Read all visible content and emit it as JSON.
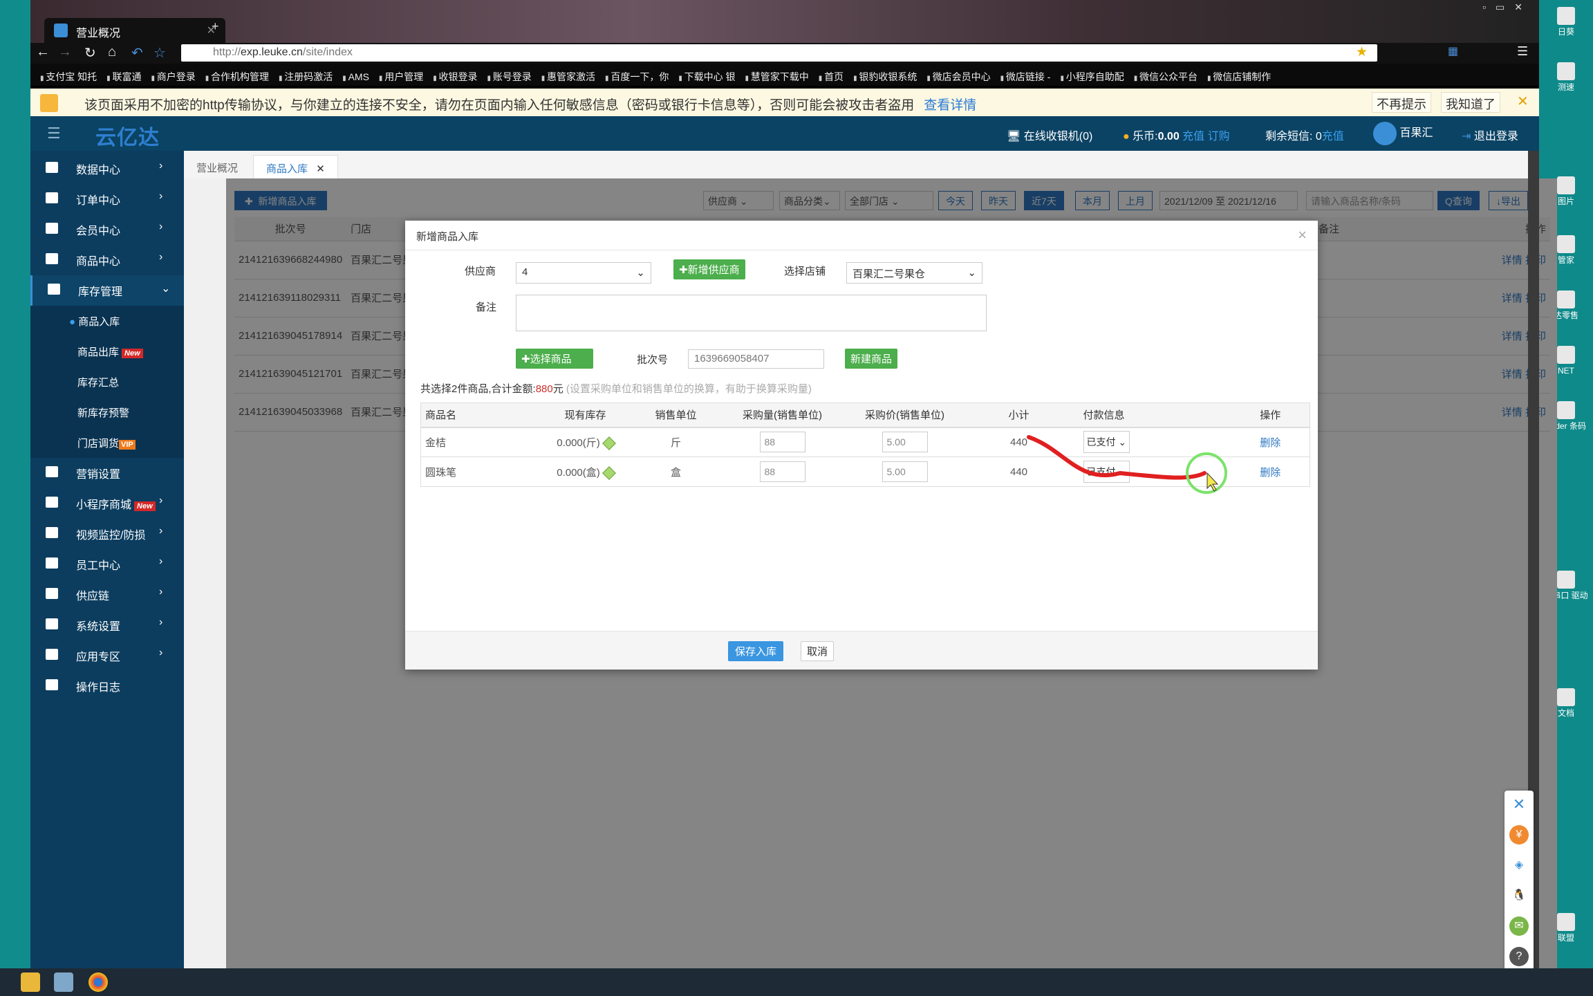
{
  "browser": {
    "tab_title": "营业概况",
    "url_scheme": "http://",
    "url_host": "exp.leuke.cn",
    "url_path": "/site/index",
    "bookmarks": [
      "支付宝 知托",
      "联富通",
      "商户登录",
      "合作机构管理",
      "注册码激活",
      "AMS",
      "用户管理",
      "收银登录",
      "账号登录",
      "惠管家激活",
      "百度一下，你",
      "下载中心 银",
      "慧管家下载中",
      "首页",
      "银豹收银系统",
      "微店会员中心",
      "微店链接 -",
      "小程序自助配",
      "微信公众平台",
      "微信店铺制作"
    ],
    "warning": {
      "text": "该页面采用不加密的http传输协议，与你建立的连接不安全，请勿在页面内输入任何敏感信息（密码或银行卡信息等），否则可能会被攻击者盗用",
      "link": "查看详情",
      "dismiss": "不再提示",
      "ok": "我知道了"
    }
  },
  "header": {
    "logo": "云亿达",
    "online_pos": "在线收银机(0)",
    "coin_label": "乐币:",
    "coin_value": "0.00",
    "recharge": "充值",
    "subscribe": "订购",
    "sms_label": "剩余短信: 0",
    "sms_recharge": "充值",
    "store": "百果汇",
    "logout": "退出登录"
  },
  "sidebar": {
    "items": [
      {
        "label": "数据中心",
        "icon": "bar-chart-icon"
      },
      {
        "label": "订单中心",
        "icon": "checklist-icon"
      },
      {
        "label": "会员中心",
        "icon": "user-icon"
      },
      {
        "label": "商品中心",
        "icon": "books-icon"
      },
      {
        "label": "库存管理",
        "icon": "book-icon"
      }
    ],
    "subitems": [
      {
        "label": "商品入库"
      },
      {
        "label": "商品出库",
        "badge": "New"
      },
      {
        "label": "库存汇总"
      },
      {
        "label": "新库存预警"
      },
      {
        "label": "门店调货",
        "badge": "VIP"
      }
    ],
    "items2": [
      {
        "label": "营销设置",
        "icon": "tag-icon"
      },
      {
        "label": "小程序商城",
        "icon": "store-icon",
        "badge": "New"
      },
      {
        "label": "视频监控/防损",
        "icon": "video-icon"
      },
      {
        "label": "员工中心",
        "icon": "user-icon"
      },
      {
        "label": "供应链",
        "icon": "truck-icon"
      },
      {
        "label": "系统设置",
        "icon": "gear-icon"
      },
      {
        "label": "应用专区",
        "icon": "cart-icon"
      },
      {
        "label": "操作日志",
        "icon": "archive-icon"
      }
    ]
  },
  "page_tabs": [
    "营业概况",
    "商品入库"
  ],
  "toolbar": {
    "add": "新增商品入库",
    "supplier": "供应商",
    "category": "商品分类",
    "store": "全部门店",
    "ranges": [
      "今天",
      "昨天",
      "近7天",
      "本月",
      "上月"
    ],
    "active_range": "近7天",
    "date_range": "2021/12/09 至 2021/12/16",
    "search_placeholder": "请输入商品名称/条码",
    "query": "查询",
    "export": "导出"
  },
  "batch_table": {
    "headers": [
      "批次号",
      "门店",
      "备注",
      "操作"
    ],
    "rows": [
      {
        "id": "214121639668244980",
        "store": "百果汇二号果仓"
      },
      {
        "id": "214121639118029311",
        "store": "百果汇二号果仓"
      },
      {
        "id": "214121639045178914",
        "store": "百果汇二号果仓"
      },
      {
        "id": "214121639045121701",
        "store": "百果汇二号果仓"
      },
      {
        "id": "214121639045033968",
        "store": "百果汇二号果仓"
      }
    ],
    "detail": "详情",
    "print": "打印"
  },
  "modal": {
    "title": "新增商品入库",
    "supplier_label": "供应商",
    "supplier_value": "4",
    "add_supplier": "新增供应商",
    "store_label": "选择店铺",
    "store_value": "百果汇二号果仓",
    "remark_label": "备注",
    "select_goods": "选择商品",
    "batch_label": "批次号",
    "batch_value": "1639669058407",
    "new_goods": "新建商品",
    "summary_prefix": "共选择2件商品,合计金额:",
    "summary_amount": "880",
    "summary_unit": "元",
    "summary_hint": "(设置采购单位和销售单位的换算，有助于换算采购量)",
    "columns": [
      "商品名",
      "现有库存",
      "销售单位",
      "采购量(销售单位)",
      "采购价(销售单位)",
      "小计",
      "付款信息",
      "操作"
    ],
    "rows": [
      {
        "name": "金桔",
        "stock": "0.000(斤)",
        "unit": "斤",
        "qty": "88",
        "price": "5.00",
        "subtotal": "440",
        "pay": "已支付",
        "action": "删除"
      },
      {
        "name": "圆珠笔",
        "stock": "0.000(盒)",
        "unit": "盒",
        "qty": "88",
        "price": "5.00",
        "subtotal": "440",
        "pay": "已支付",
        "action": "删除"
      }
    ],
    "save": "保存入库",
    "cancel": "取消"
  },
  "desktop": {
    "right_labels": [
      "日葵",
      "测速",
      "图片",
      "管家",
      "达零售",
      "NET",
      "ender 条码",
      "转串口 驱动",
      "文档",
      "联盟"
    ]
  },
  "colors": {
    "sidebar": "#0c3d5f",
    "primary": "#2e78c2",
    "green": "#4cae4c",
    "amount": "#c9302c"
  }
}
